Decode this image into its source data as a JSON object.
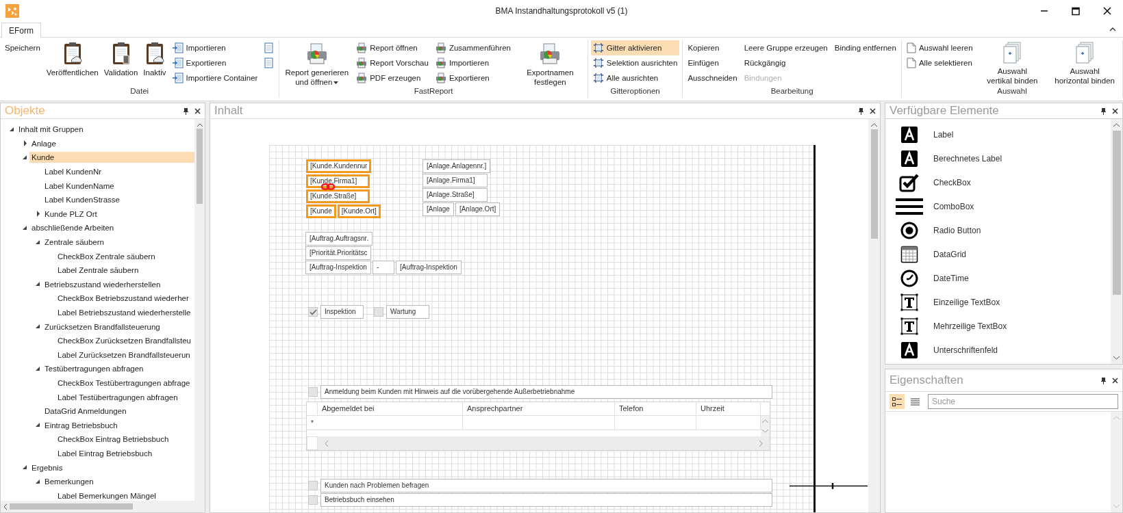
{
  "window": {
    "title": "BMA Instandhaltungsprotokoll v5 (1)"
  },
  "tabs": [
    {
      "label": "EForm",
      "selected": true
    }
  ],
  "ribbon": {
    "groups": [
      {
        "label": "Datei",
        "columns": [
          [
            {
              "label": "Speichern",
              "kind": "plain"
            }
          ],
          [
            {
              "label": "Veröffentlichen",
              "kind": "large"
            }
          ],
          [
            {
              "label": "Validation",
              "kind": "large"
            }
          ],
          [
            {
              "label": "Inaktiv",
              "kind": "large"
            }
          ],
          [
            {
              "label": "Importieren",
              "kind": "small"
            },
            {
              "label": "Exportieren",
              "kind": "small"
            },
            {
              "label": "Importiere Container",
              "kind": "small"
            }
          ],
          [
            {
              "kind": "icon"
            },
            {
              "kind": "icon"
            }
          ]
        ]
      },
      {
        "label": "FastReport",
        "columns": [
          [
            {
              "label": "Report generieren und öffnen",
              "kind": "large-menu"
            }
          ],
          [
            {
              "label": "Report öffnen",
              "kind": "small"
            },
            {
              "label": "Report Vorschau",
              "kind": "small"
            },
            {
              "label": "PDF erzeugen",
              "kind": "small"
            }
          ],
          [
            {
              "label": "Zusammenführen",
              "kind": "small"
            },
            {
              "label": "Importieren",
              "kind": "small"
            },
            {
              "label": "Exportieren",
              "kind": "small"
            }
          ],
          [
            {
              "label": "Exportnamen festlegen",
              "kind": "large"
            }
          ]
        ]
      },
      {
        "label": "Gitteroptionen",
        "columns": [
          [
            {
              "label": "Gitter aktivieren",
              "kind": "small",
              "on": true
            },
            {
              "label": "Selektion ausrichten",
              "kind": "small",
              "on": false
            },
            {
              "label": "Alle ausrichten",
              "kind": "small",
              "on": false
            }
          ]
        ]
      },
      {
        "label": "Bearbeitung",
        "columns": [
          [
            {
              "label": "Kopieren",
              "kind": "plain",
              "disabled": false
            },
            {
              "label": "Einfügen",
              "kind": "plain",
              "disabled": false
            },
            {
              "label": "Ausschneiden",
              "kind": "plain",
              "disabled": false
            }
          ],
          [
            {
              "label": "Leere Gruppe erzeugen",
              "kind": "plain",
              "disabled": false
            },
            {
              "label": "Rückgängig",
              "kind": "plain",
              "disabled": false
            },
            {
              "label": "Bindungen",
              "kind": "plain",
              "disabled": true
            }
          ],
          [
            {
              "label": "Binding entfernen",
              "kind": "plain",
              "disabled": false
            }
          ]
        ]
      },
      {
        "label": "Auswahl",
        "columns": [
          [
            {
              "label": "Auswahl leeren",
              "kind": "small"
            },
            {
              "label": "Alle selektieren",
              "kind": "small"
            }
          ],
          [
            {
              "label": "Auswahl vertikal binden",
              "kind": "large"
            }
          ],
          [
            {
              "label": "Auswahl horizontal binden",
              "kind": "large"
            }
          ]
        ]
      }
    ]
  },
  "objects_pane": {
    "title": "Objekte",
    "active": true,
    "tree": [
      {
        "label": "Inhalt mit Gruppen",
        "expanded": true,
        "selected": false,
        "children": [
          {
            "label": "Anlage",
            "expanded": false,
            "selected": false
          },
          {
            "label": "Kunde",
            "expanded": true,
            "selected": true,
            "children": [
              {
                "label": "Label KundenNr",
                "selected": false
              },
              {
                "label": "Label KundenName",
                "selected": false
              },
              {
                "label": "Label KundenStrasse",
                "selected": false
              },
              {
                "label": "Kunde PLZ Ort",
                "expanded": false,
                "selected": false
              }
            ]
          },
          {
            "label": "abschließende Arbeiten",
            "expanded": true,
            "selected": false,
            "children": [
              {
                "label": "Zentrale säubern",
                "expanded": true,
                "selected": false,
                "children": [
                  {
                    "label": "CheckBox Zentrale säubern",
                    "selected": false
                  },
                  {
                    "label": "Label Zentrale säubern",
                    "selected": false
                  }
                ]
              },
              {
                "label": "Betriebszustand wiederherstellen",
                "expanded": true,
                "selected": false,
                "children": [
                  {
                    "label": "CheckBox Betriebszustand wiederher",
                    "selected": false
                  },
                  {
                    "label": "Label Betriebszustand wiederherstelle",
                    "selected": false
                  }
                ]
              },
              {
                "label": "Zurücksetzen Brandfallsteuerung",
                "expanded": true,
                "selected": false,
                "children": [
                  {
                    "label": "CheckBox Zurücksetzen Brandfallsteu",
                    "selected": false
                  },
                  {
                    "label": "Label Zurücksetzen Brandfallsteuerun",
                    "selected": false
                  }
                ]
              },
              {
                "label": "Testübertragungen abfragen",
                "expanded": true,
                "selected": false,
                "children": [
                  {
                    "label": "CheckBox Testübertragungen abfrage",
                    "selected": false
                  },
                  {
                    "label": "Label Testübertragungen abfragen",
                    "selected": false
                  }
                ]
              },
              {
                "label": "DataGrid Anmeldungen",
                "selected": false
              },
              {
                "label": "Eintrag Betriebsbuch",
                "expanded": true,
                "selected": false,
                "children": [
                  {
                    "label": "CheckBox Eintrag Betriebsbuch",
                    "selected": false
                  },
                  {
                    "label": "Label Eintrag Betriebsbuch",
                    "selected": false
                  }
                ]
              }
            ]
          },
          {
            "label": "Ergebnis",
            "expanded": true,
            "selected": false,
            "children": [
              {
                "label": "Bemerkungen",
                "expanded": true,
                "selected": false,
                "children": [
                  {
                    "label": "Label Bemerkungen Mängel",
                    "selected": false
                  }
                ]
              }
            ]
          }
        ]
      }
    ]
  },
  "content_pane": {
    "title": "Inhalt",
    "active": false,
    "elements": [
      {
        "kind": "field",
        "text": "[Kunde.Kundennur",
        "selected": true
      },
      {
        "kind": "field",
        "text": "[Kunde.Firma1]",
        "selected": true
      },
      {
        "kind": "field",
        "text": "[Kunde.Straße]",
        "selected": true
      },
      {
        "kind": "field",
        "text": "[Kunde",
        "selected": true
      },
      {
        "kind": "field",
        "text": "[Kunde.Ort]",
        "selected": true
      },
      {
        "kind": "field",
        "text": "[Anlage.Anlagennr.]",
        "selected": false
      },
      {
        "kind": "field",
        "text": "[Anlage.Firma1]",
        "selected": false
      },
      {
        "kind": "field",
        "text": "[Anlage.Straße]",
        "selected": false
      },
      {
        "kind": "field",
        "text": "[Anlage",
        "selected": false
      },
      {
        "kind": "field",
        "text": "[Anlage.Ort]",
        "selected": false
      },
      {
        "kind": "field",
        "text": "[Auftrag.Auftragsnr.",
        "selected": false
      },
      {
        "kind": "field",
        "text": "[Priorität.Prioritätsc",
        "selected": false
      },
      {
        "kind": "field",
        "text": "[Auftrag-Inspektion",
        "selected": false
      },
      {
        "kind": "field",
        "text": "-",
        "selected": false
      },
      {
        "kind": "field",
        "text": "[Auftrag-Inspektion",
        "selected": false
      },
      {
        "kind": "checkbox",
        "text": "Inspektion",
        "checked": true,
        "selected": false
      },
      {
        "kind": "checkbox",
        "text": "Wartung",
        "checked": false,
        "selected": false
      },
      {
        "kind": "checkbox",
        "text": "Anmeldung beim Kunden mit Hinweis auf die vorübergehende Außerbetriebnahme",
        "checked": false,
        "selected": false
      },
      {
        "kind": "grid",
        "columns": [
          "Abgemeldet bei",
          "Ansprechpartner",
          "Telefon",
          "Uhrzeit"
        ],
        "new_row_marker": "*",
        "selected": false
      },
      {
        "kind": "checkbox",
        "text": "Kunden nach Problemen befragen",
        "checked": false,
        "selected": false
      },
      {
        "kind": "checkbox",
        "text": "Betriebsbuch einsehen",
        "checked": false,
        "selected": false
      }
    ]
  },
  "toolbox_pane": {
    "title": "Verfügbare Elemente",
    "active": false,
    "items": [
      {
        "label": "Label",
        "kind": "label"
      },
      {
        "label": "Berechnetes Label",
        "kind": "label"
      },
      {
        "label": "CheckBox",
        "kind": "checkbox"
      },
      {
        "label": "ComboBox",
        "kind": "combobox"
      },
      {
        "label": "Radio Button",
        "kind": "radio"
      },
      {
        "label": "DataGrid",
        "kind": "datagrid"
      },
      {
        "label": "DateTime",
        "kind": "datetime"
      },
      {
        "label": "Einzeilige TextBox",
        "kind": "textbox"
      },
      {
        "label": "Mehrzeilige TextBox",
        "kind": "textbox"
      },
      {
        "label": "Unterschriftenfeld",
        "kind": "label"
      }
    ]
  },
  "properties_pane": {
    "title": "Eigenschaften",
    "active": false,
    "view_buttons": [
      {
        "kind": "categorized",
        "selected": true
      },
      {
        "kind": "alphabetical",
        "selected": false
      }
    ],
    "search": {
      "placeholder": "Suche"
    }
  }
}
